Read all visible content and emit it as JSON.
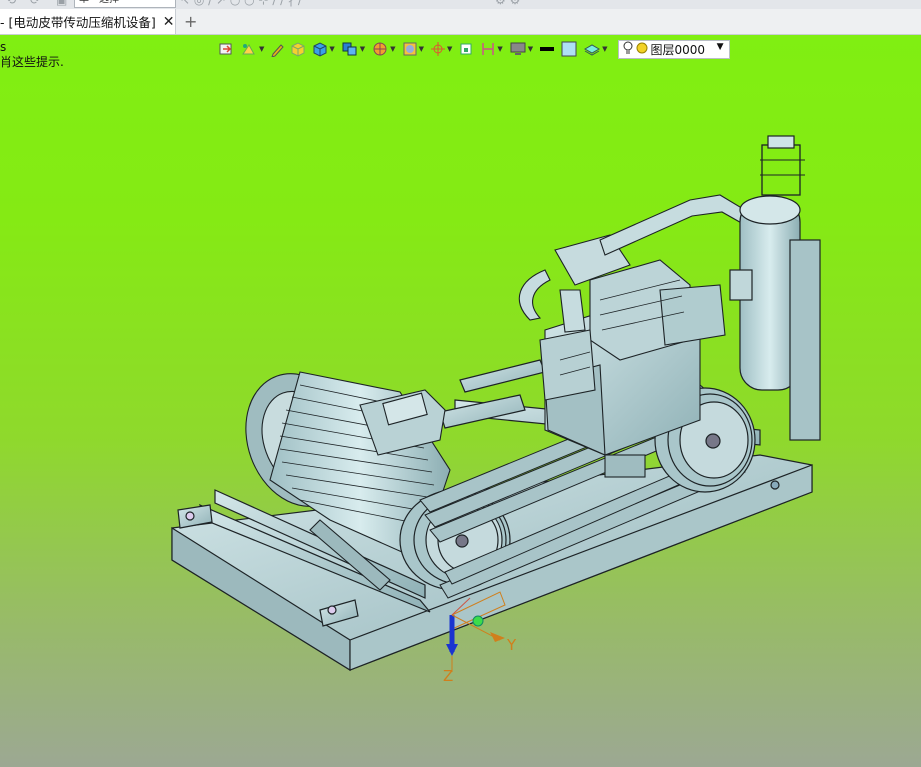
{
  "topbar": {
    "select_label": "单一选择"
  },
  "tab": {
    "title": "- [电动皮带传动压缩机设备]",
    "close_glyph": "✕",
    "new_tab_glyph": "+"
  },
  "viewport": {
    "hint_line1": "s",
    "hint_line2": "肖这些提示."
  },
  "toolbar": {
    "layer_label": "图层0000"
  },
  "axes": {
    "y_label": "Y",
    "z_label": "Z"
  },
  "colors": {
    "viewport_top": "#80ef12",
    "viewport_bottom": "#9ca893",
    "model_fill": "#b5cfd2",
    "model_edge": "#1d2326",
    "axis_z": "#1a34d0",
    "axis_label": "#d07f1c"
  }
}
